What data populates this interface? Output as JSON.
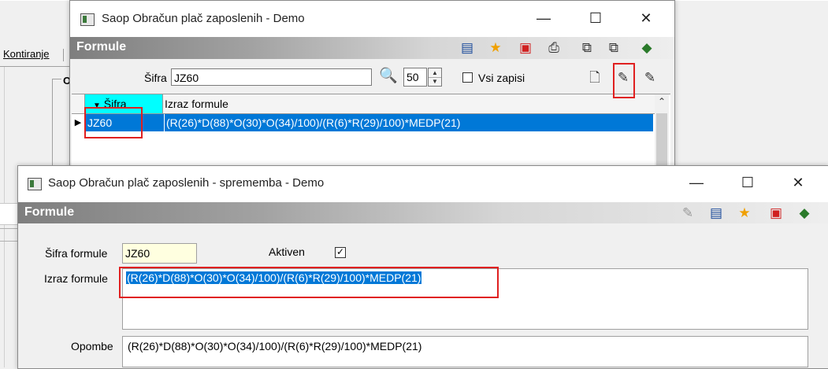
{
  "background": {
    "tab_label": "Kontiranje",
    "group_label": "O"
  },
  "window1": {
    "title": "Saop Obračun plač zaposlenih - Demo",
    "ribbon_title": "Formule",
    "search": {
      "label": "Šifra",
      "value": "JZ60",
      "count": "50",
      "all_records_label": "Vsi zapisi"
    },
    "grid": {
      "columns": [
        "Šifra",
        "Izraz formule"
      ],
      "rows": [
        {
          "sifra": "JZ60",
          "izraz": "(R(26)*D(88)*O(30)*O(34)/100)/(R(6)*R(29)/100)*MEDP(21)"
        }
      ]
    }
  },
  "window2": {
    "title": "Saop Obračun plač zaposlenih - sprememba - Demo",
    "ribbon_title": "Formule",
    "fields": {
      "sifra_label": "Šifra formule",
      "sifra_value": "JZ60",
      "aktiven_label": "Aktiven",
      "aktiven_checked": "✓",
      "izraz_label": "Izraz formule",
      "izraz_value": "(R(26)*D(88)*O(30)*O(34)/100)/(R(6)*R(29)/100)*MEDP(21)",
      "opombe_label": "Opombe",
      "opombe_value": "(R(26)*D(88)*O(30)*O(34)/100)/(R(6)*R(29)/100)*MEDP(21)"
    }
  },
  "window_controls": {
    "minimize": "—",
    "maximize": "☐",
    "close": "✕"
  },
  "colors": {
    "selection": "#0078d7",
    "highlight_box": "#e02020",
    "header_cyan": "#00ffff",
    "input_yellow": "#ffffe0"
  }
}
